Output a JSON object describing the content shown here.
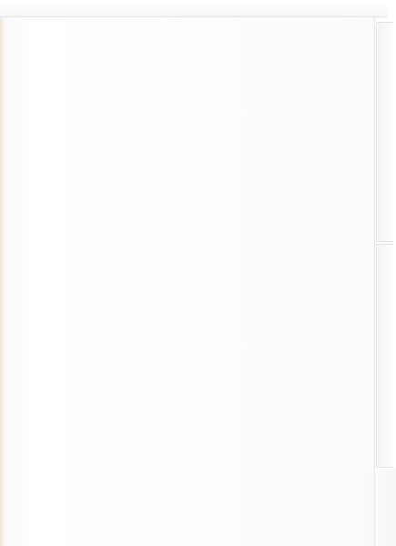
{
  "scene": {
    "subject": "",
    "colors": {
      "body": "#ffffff",
      "edge": "#e3e3e3",
      "wood_edge": "#f2e6d6"
    }
  }
}
